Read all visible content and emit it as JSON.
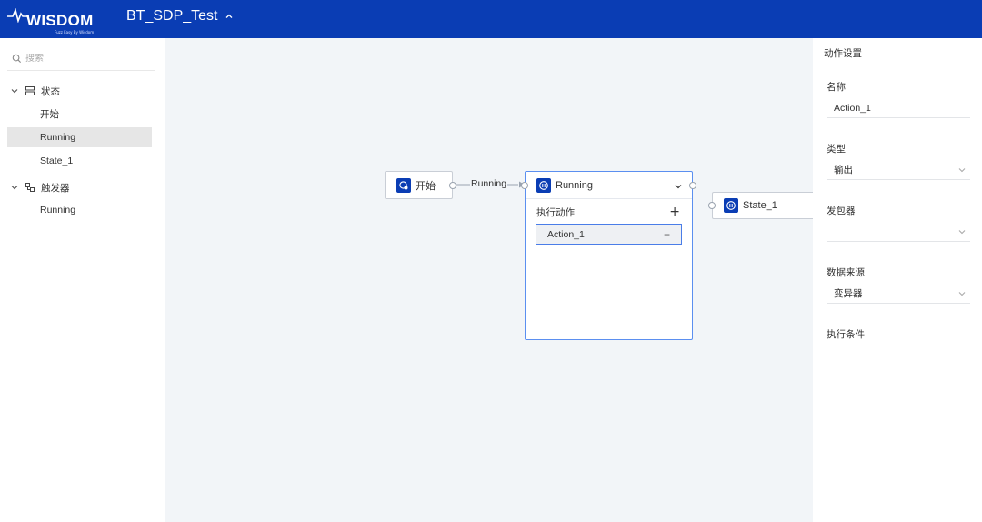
{
  "header": {
    "logo_text": "WISDOM",
    "logo_tagline": "Fuzz Easy By Wisdom",
    "project_name": "BT_SDP_Test"
  },
  "sidebar": {
    "search_placeholder": "搜索",
    "groups": [
      {
        "label": "状态",
        "icon": "state-icon",
        "items": [
          "开始",
          "Running",
          "State_1"
        ]
      },
      {
        "label": "触发器",
        "icon": "trigger-icon",
        "items": [
          "Running"
        ]
      }
    ],
    "selected_item": "Running"
  },
  "canvas": {
    "nodes": {
      "start": {
        "label": "开始"
      },
      "running": {
        "label": "Running",
        "section_label": "执行动作",
        "action": "Action_1"
      },
      "state1": {
        "label": "State_1"
      }
    },
    "edge_label": "Running"
  },
  "panel": {
    "title": "动作设置",
    "fields": {
      "name": {
        "label": "名称",
        "value": "Action_1"
      },
      "type": {
        "label": "类型",
        "value": "输出"
      },
      "sender": {
        "label": "发包器",
        "value": ""
      },
      "datasource": {
        "label": "数据来源",
        "value": "变异器"
      },
      "condition": {
        "label": "执行条件",
        "value": ""
      }
    }
  },
  "colors": {
    "header_bg": "#0a3db4",
    "canvas_bg": "#f2f5f8",
    "accent": "#4a7de8"
  }
}
